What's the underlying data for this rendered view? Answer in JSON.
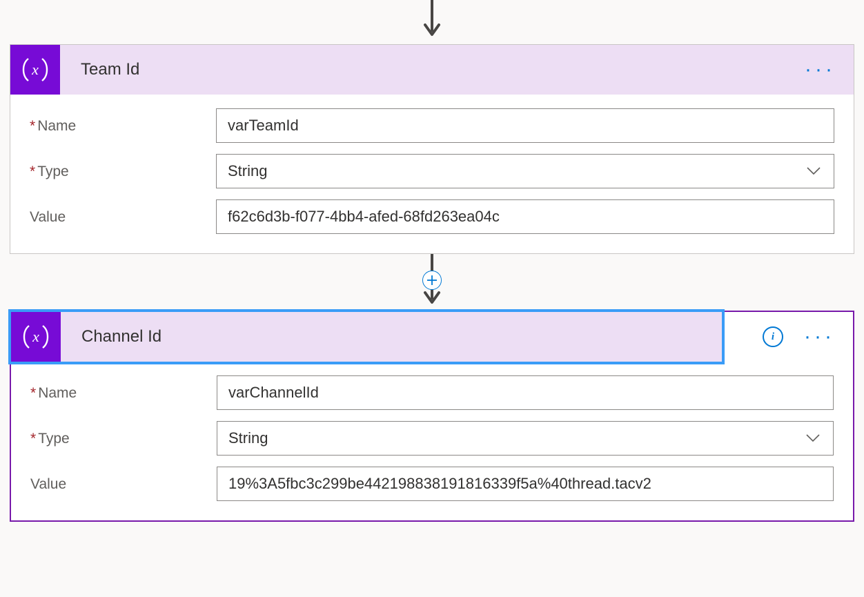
{
  "connector": {
    "plus_label": "+"
  },
  "labels": {
    "name": "Name",
    "type": "Type",
    "value": "Value"
  },
  "cards": [
    {
      "title": "Team Id",
      "name_value": "varTeamId",
      "type_value": "String",
      "value_value": "f62c6d3b-f077-4bb4-afed-68fd263ea04c",
      "ellipsis": "···",
      "show_info": false,
      "selected": false
    },
    {
      "title": "Channel Id",
      "name_value": "varChannelId",
      "type_value": "String",
      "value_value": "19%3A5fbc3c299be442198838191816339f5a%40thread.tacv2",
      "ellipsis": "···",
      "info_label": "i",
      "show_info": true,
      "selected": true
    }
  ]
}
